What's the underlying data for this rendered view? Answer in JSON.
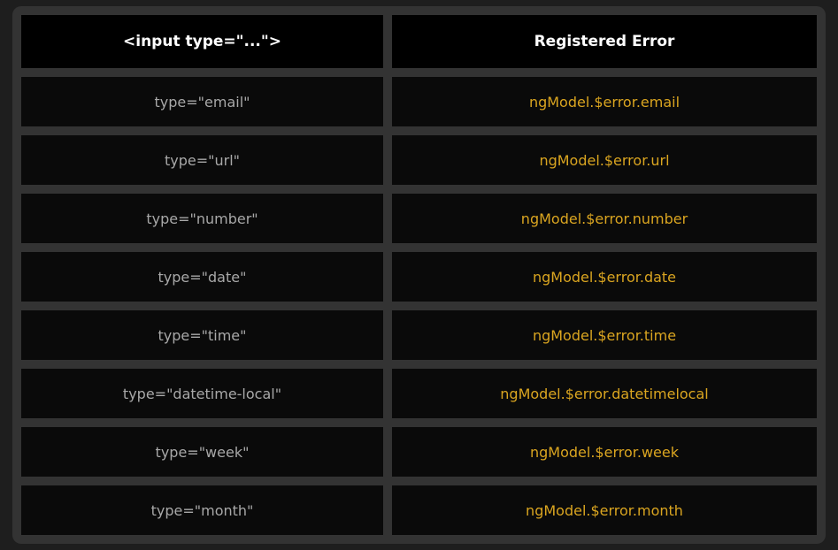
{
  "table": {
    "headers": [
      "<input type=\"...\">",
      "Registered Error"
    ],
    "rows": [
      {
        "type": "type=\"email\"",
        "error": "ngModel.$error.email"
      },
      {
        "type": "type=\"url\"",
        "error": "ngModel.$error.url"
      },
      {
        "type": "type=\"number\"",
        "error": "ngModel.$error.number"
      },
      {
        "type": "type=\"date\"",
        "error": "ngModel.$error.date"
      },
      {
        "type": "type=\"time\"",
        "error": "ngModel.$error.time"
      },
      {
        "type": "type=\"datetime-local\"",
        "error": "ngModel.$error.datetimelocal"
      },
      {
        "type": "type=\"week\"",
        "error": "ngModel.$error.week"
      },
      {
        "type": "type=\"month\"",
        "error": "ngModel.$error.month"
      }
    ]
  },
  "colors": {
    "background": "#1e1e1e",
    "frame": "#333333",
    "header_bg": "#000000",
    "cell_bg": "#0a0a0a",
    "type_text": "#a8a8a8",
    "error_text": "#daa520",
    "header_text": "#ffffff"
  }
}
